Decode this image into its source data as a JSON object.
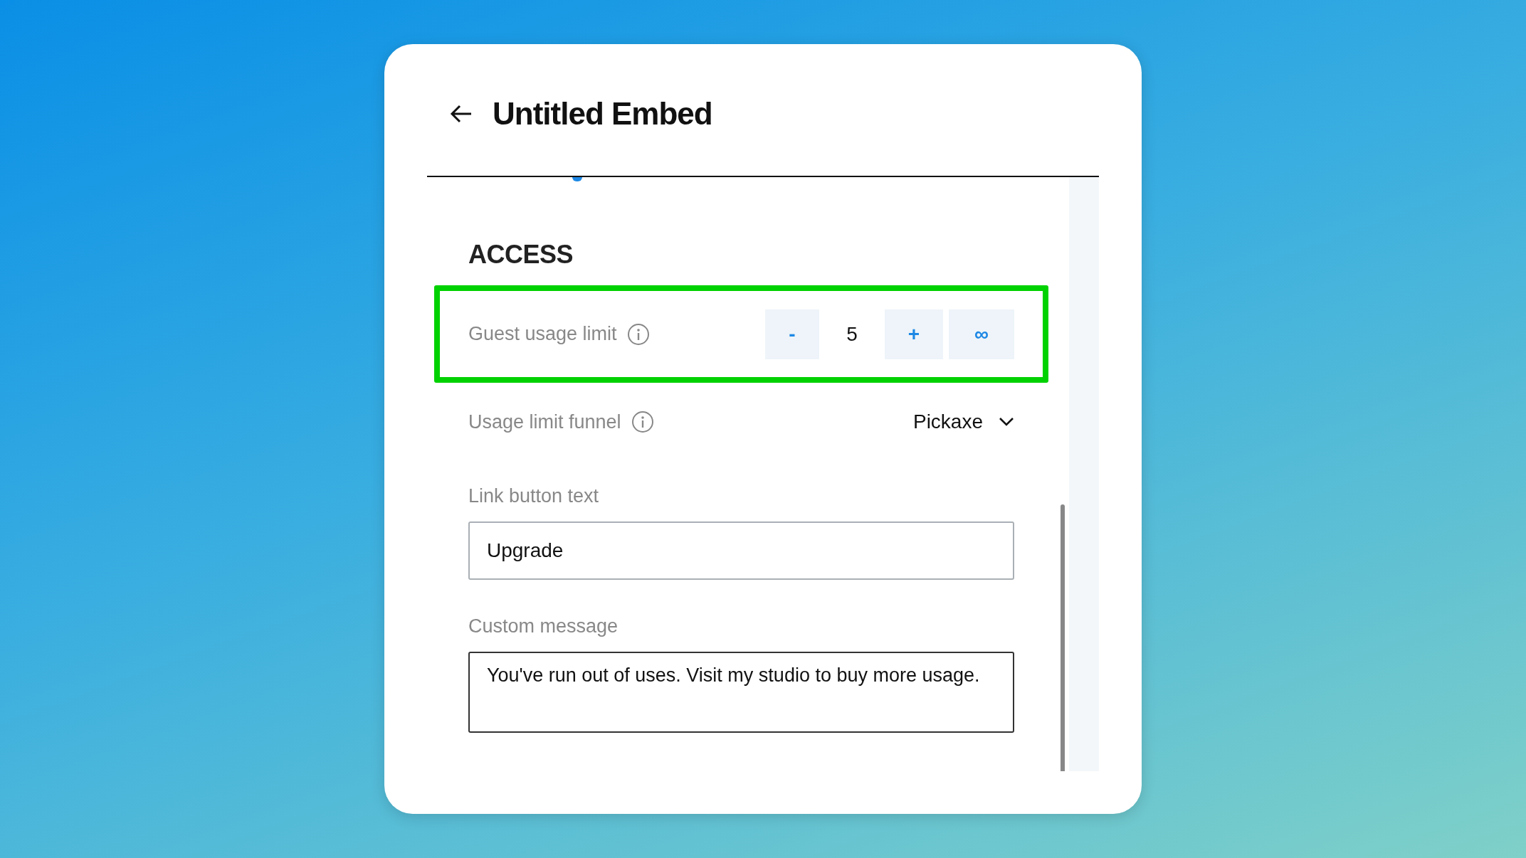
{
  "header": {
    "title": "Untitled Embed"
  },
  "section": {
    "title": "ACCESS"
  },
  "rows": [
    {
      "kind": "stepper",
      "label": "Guest usage limit",
      "info": true,
      "highlighted": true,
      "decrement": "-",
      "value": "5",
      "increment": "+",
      "unlimited": "∞"
    },
    {
      "kind": "select",
      "label": "Usage limit funnel",
      "info": true,
      "highlighted": false,
      "value": "Pickaxe"
    },
    {
      "kind": "text",
      "label": "Link button text",
      "value": "Upgrade"
    },
    {
      "kind": "textarea",
      "label": "Custom message",
      "value": "You've run out of uses. Visit my studio to buy more usage."
    }
  ]
}
